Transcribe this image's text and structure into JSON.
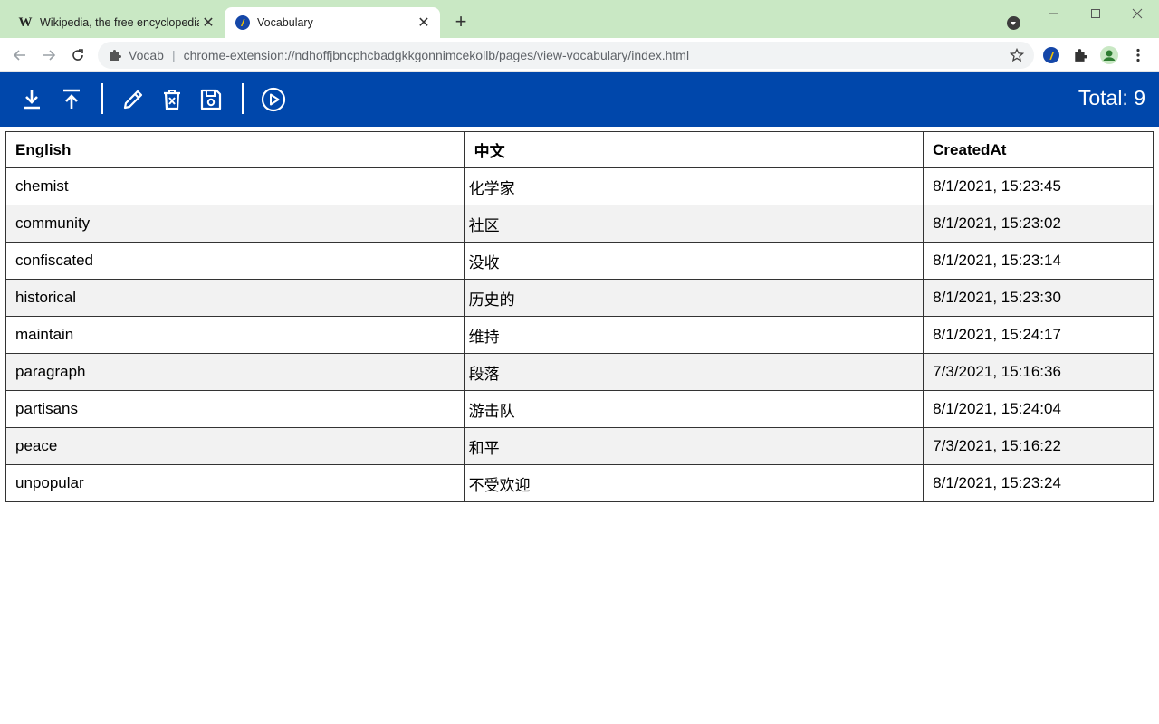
{
  "browser": {
    "tabs": [
      {
        "title": "Wikipedia, the free encyclopedia",
        "favicon": "W",
        "active": false
      },
      {
        "title": "Vocabulary",
        "favicon": "vocab-logo",
        "active": true
      }
    ],
    "new_tab_label": "+",
    "address": {
      "chip": "Vocab",
      "url": "chrome-extension://ndhoffjbncphcbadgkkgonnimcekollb/pages/view-vocabulary/index.html"
    }
  },
  "app": {
    "accent_color": "#0047ab",
    "toolbar_icons": [
      "download-icon",
      "upload-icon",
      "edit-icon",
      "delete-icon",
      "save-icon",
      "play-icon"
    ],
    "total_label": "Total: 9"
  },
  "table": {
    "headers": {
      "english": "English",
      "chinese": "中文",
      "created": "CreatedAt"
    },
    "rows": [
      {
        "english": "chemist",
        "chinese": "化学家",
        "created": "8/1/2021, 15:23:45"
      },
      {
        "english": "community",
        "chinese": "社区",
        "created": "8/1/2021, 15:23:02"
      },
      {
        "english": "confiscated",
        "chinese": "没收",
        "created": "8/1/2021, 15:23:14"
      },
      {
        "english": "historical",
        "chinese": "历史的",
        "created": "8/1/2021, 15:23:30"
      },
      {
        "english": "maintain",
        "chinese": "维持",
        "created": "8/1/2021, 15:24:17"
      },
      {
        "english": "paragraph",
        "chinese": "段落",
        "created": "7/3/2021, 15:16:36"
      },
      {
        "english": "partisans",
        "chinese": "游击队",
        "created": "8/1/2021, 15:24:04"
      },
      {
        "english": "peace",
        "chinese": "和平",
        "created": "7/3/2021, 15:16:22"
      },
      {
        "english": "unpopular",
        "chinese": "不受欢迎",
        "created": "8/1/2021, 15:23:24"
      }
    ]
  }
}
